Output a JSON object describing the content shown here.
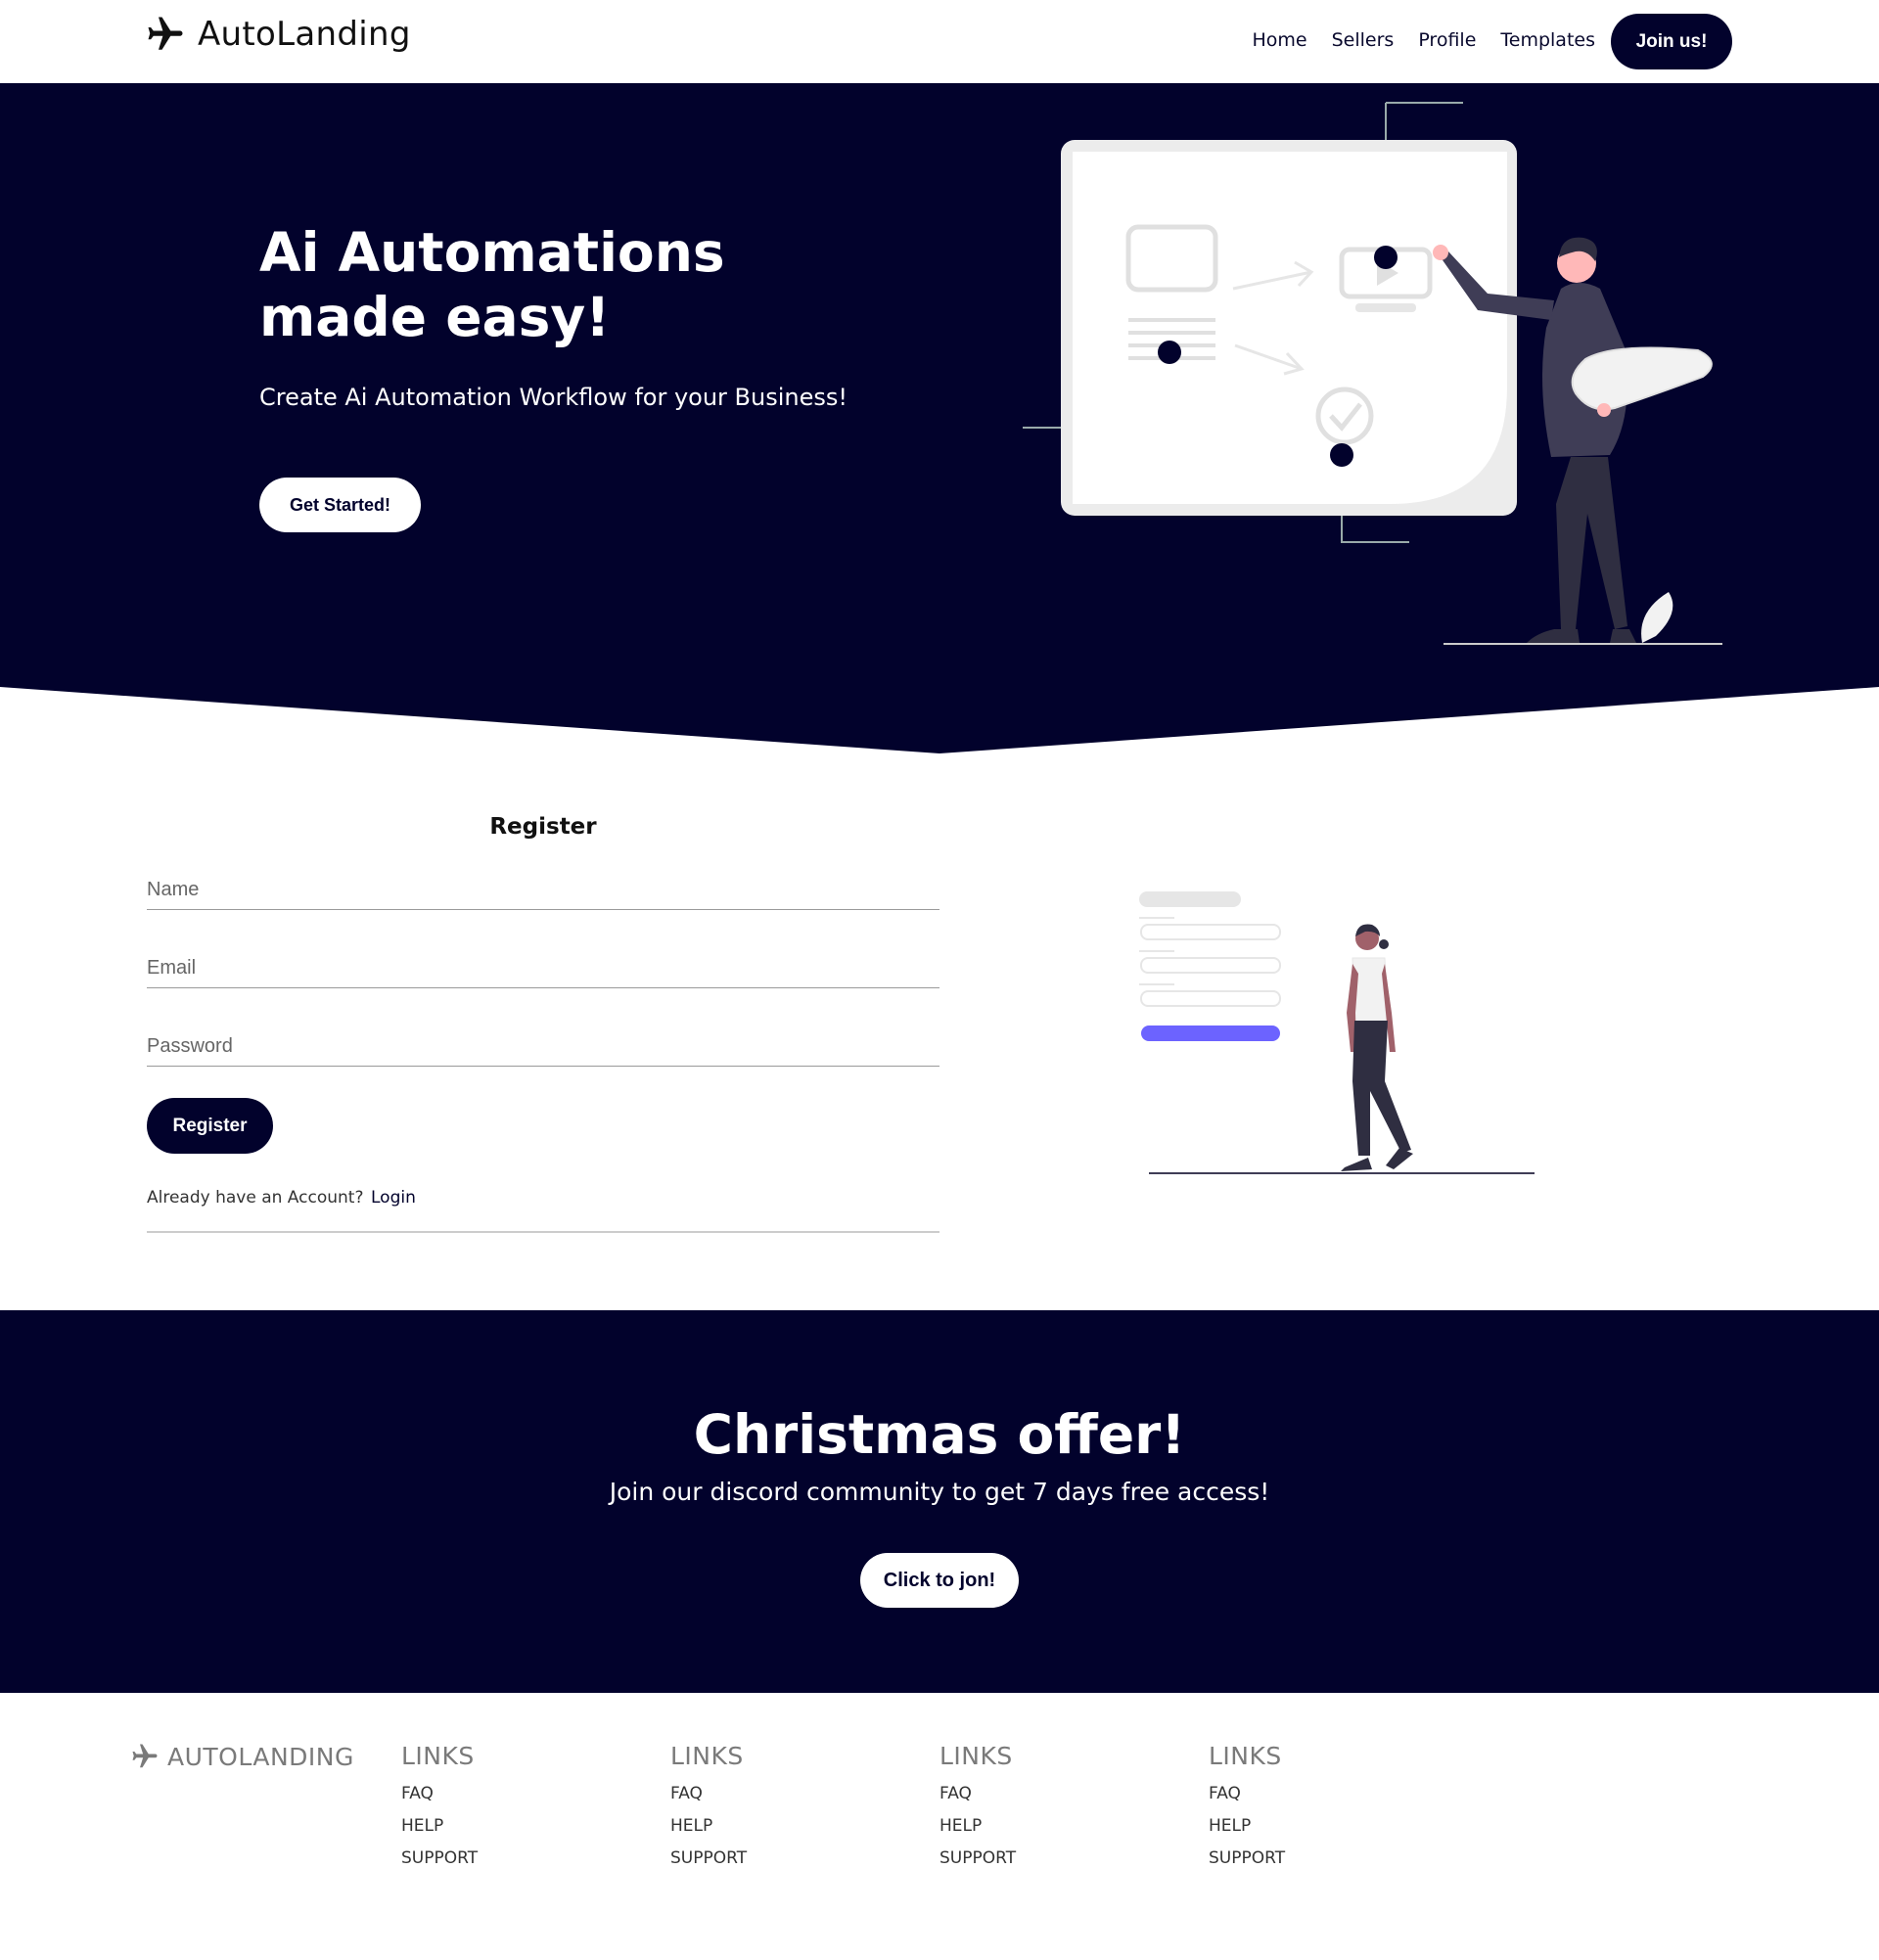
{
  "navbar": {
    "brand": "AutoLanding",
    "links": [
      "Home",
      "Sellers",
      "Profile",
      "Templates"
    ],
    "join_label": "Join us!"
  },
  "hero": {
    "title": "Ai Automations made easy!",
    "subtitle": "Create Ai Automation Workflow for your Business!",
    "cta_label": "Get Started!"
  },
  "register": {
    "title": "Register",
    "name_placeholder": "Name",
    "email_placeholder": "Email",
    "password_placeholder": "Password",
    "button_label": "Register",
    "already_text": "Already have an Account?",
    "login_label": "Login"
  },
  "offer": {
    "title": "Christmas offer!",
    "subtitle": "Join our discord community to get 7 days free access!",
    "button_label": "Click to jon!"
  },
  "footer": {
    "brand": "AUTOLANDING",
    "columns": [
      {
        "heading": "LINKS",
        "links": [
          "FAQ",
          "HELP",
          "SUPPORT"
        ]
      },
      {
        "heading": "LINKS",
        "links": [
          "FAQ",
          "HELP",
          "SUPPORT"
        ]
      },
      {
        "heading": "LINKS",
        "links": [
          "FAQ",
          "HELP",
          "SUPPORT"
        ]
      },
      {
        "heading": "LINKS",
        "links": [
          "FAQ",
          "HELP",
          "SUPPORT"
        ]
      }
    ]
  },
  "colors": {
    "navy": "#02022c",
    "accent": "#6c63ff",
    "white": "#ffffff"
  }
}
